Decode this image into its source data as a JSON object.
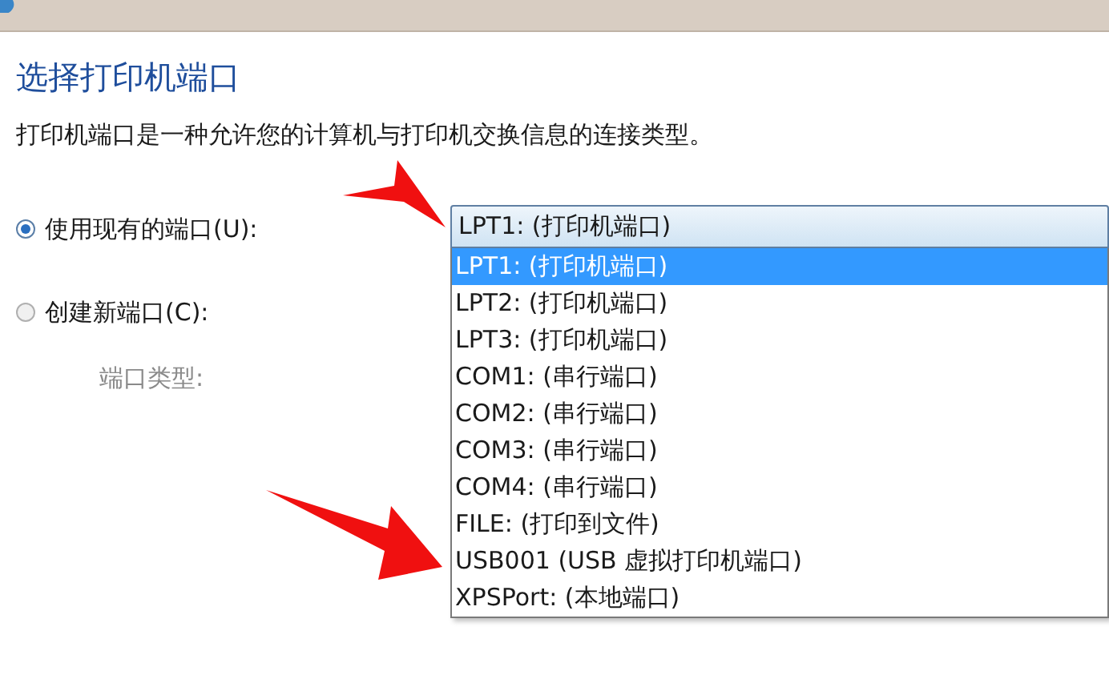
{
  "heading": "选择打印机端口",
  "description": "打印机端口是一种允许您的计算机与打印机交换信息的连接类型。",
  "options": [
    {
      "label": "使用现有的端口(U):",
      "selected": true
    },
    {
      "label": "创建新端口(C):",
      "selected": false
    }
  ],
  "port_type_label": "端口类型:",
  "combo": {
    "value": "LPT1: (打印机端口)",
    "expanded": true
  },
  "ports": [
    {
      "label": "LPT1: (打印机端口)",
      "selected": true
    },
    {
      "label": "LPT2: (打印机端口)",
      "selected": false
    },
    {
      "label": "LPT3: (打印机端口)",
      "selected": false
    },
    {
      "label": "COM1: (串行端口)",
      "selected": false
    },
    {
      "label": "COM2: (串行端口)",
      "selected": false
    },
    {
      "label": "COM3: (串行端口)",
      "selected": false
    },
    {
      "label": "COM4: (串行端口)",
      "selected": false
    },
    {
      "label": "FILE: (打印到文件)",
      "selected": false
    },
    {
      "label": "USB001 (USB 虚拟打印机端口)",
      "selected": false
    },
    {
      "label": "XPSPort: (本地端口)",
      "selected": false
    }
  ]
}
